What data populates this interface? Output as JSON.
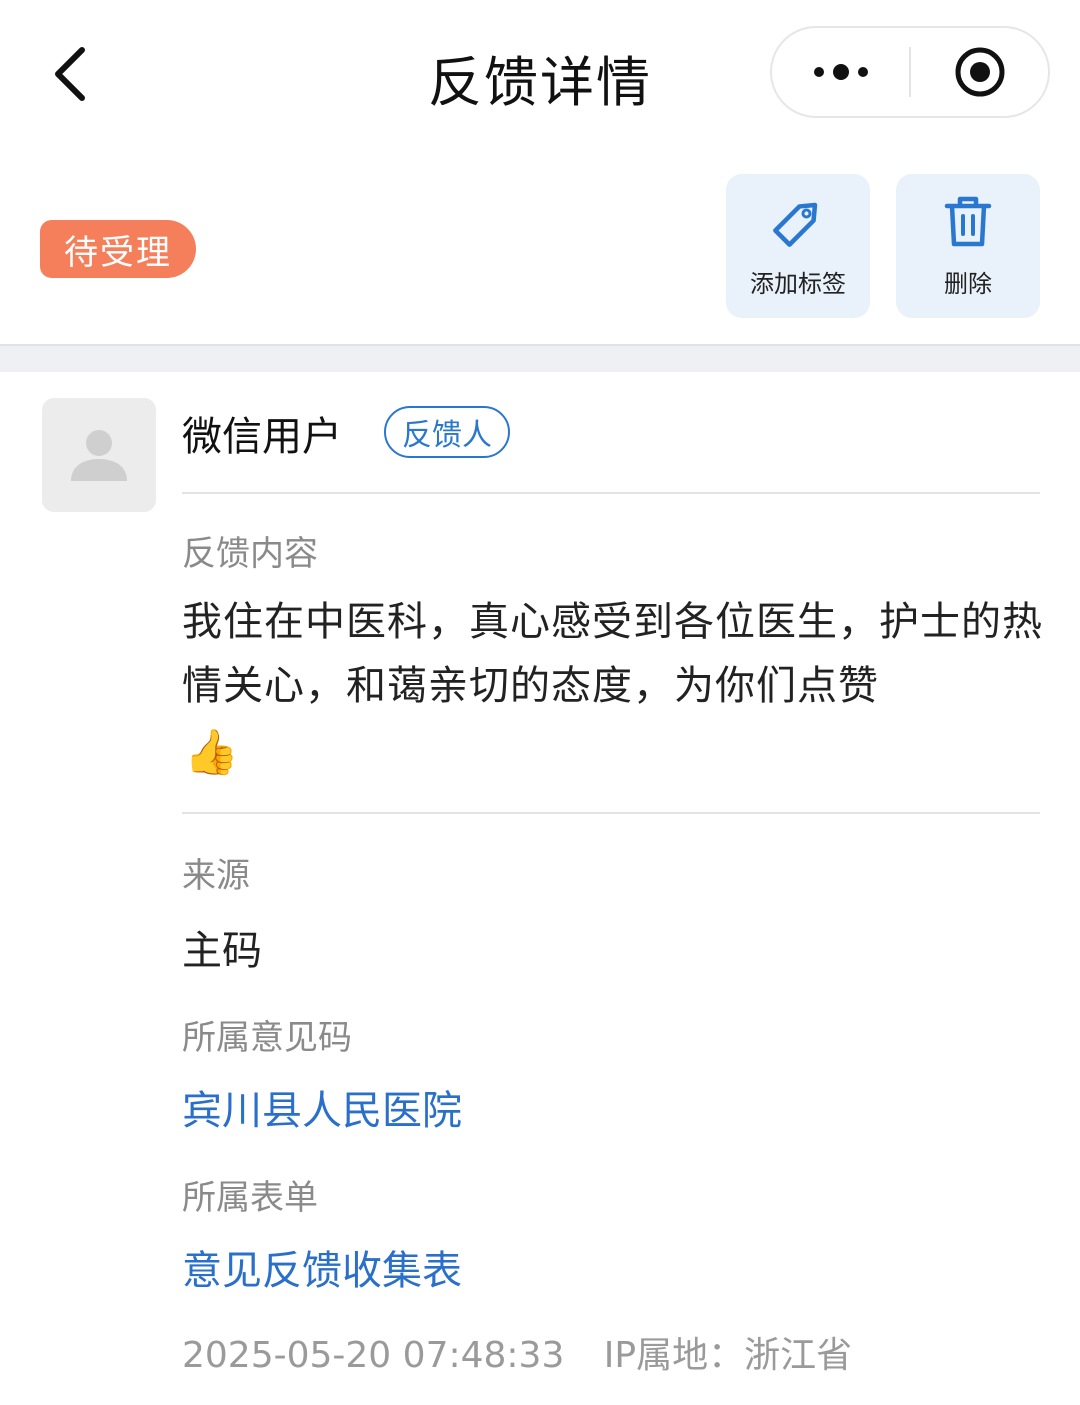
{
  "header": {
    "title": "反馈详情",
    "back_icon": "chevron-left-icon",
    "more_icon": "more-dots-icon",
    "close_icon": "target-circle-icon"
  },
  "status": {
    "label": "待受理",
    "color": "#f57f5b"
  },
  "actions": {
    "add_tag_label": "添加标签",
    "add_tag_icon": "tag-icon",
    "delete_label": "删除",
    "delete_icon": "trash-icon",
    "accent": "#2a77d0"
  },
  "feedback": {
    "user_name": "微信用户",
    "role": "反馈人",
    "content_label": "反馈内容",
    "content": "我住在中医科，真心感受到各位医生，护士的热情关心，和蔼亲切的态度，为你们点赞",
    "emoji": "👍",
    "source_label": "来源",
    "source": "主码",
    "code_label": "所属意见码",
    "code": "宾川县人民医院",
    "form_label": "所属表单",
    "form": "意见反馈收集表",
    "timestamp": "2025-05-20 07:48:33",
    "ip": "IP属地：浙江省"
  }
}
